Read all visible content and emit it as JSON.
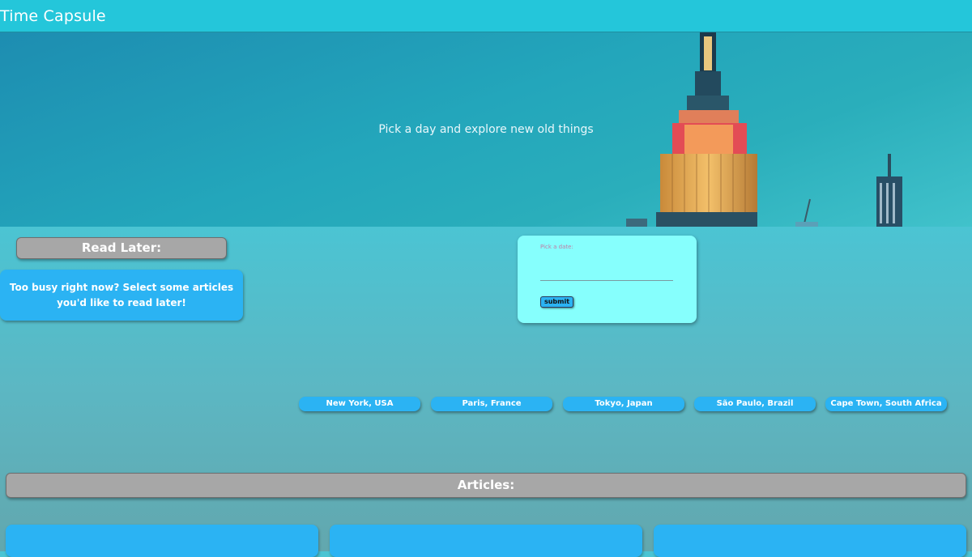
{
  "header": {
    "title": "Time Capsule"
  },
  "hero": {
    "tagline": "Pick a day and explore new old things"
  },
  "read_later": {
    "heading": "Read Later:",
    "empty_message": "Too busy right now? Select some articles you'd like to read later!"
  },
  "date_picker": {
    "label": "Pick a date:",
    "value": "",
    "submit_label": "submit"
  },
  "cities": [
    {
      "label": "New York, USA"
    },
    {
      "label": "Paris, France"
    },
    {
      "label": "Tokyo, Japan"
    },
    {
      "label": "São Paulo, Brazil"
    },
    {
      "label": "Cape Town, South Africa"
    }
  ],
  "articles": {
    "heading": "Articles:"
  },
  "colors": {
    "topbar": "#24c6da",
    "accent_blue": "#2bb3f3",
    "panel_cyan": "#86fffd",
    "header_gray": "#a7a7a7"
  }
}
